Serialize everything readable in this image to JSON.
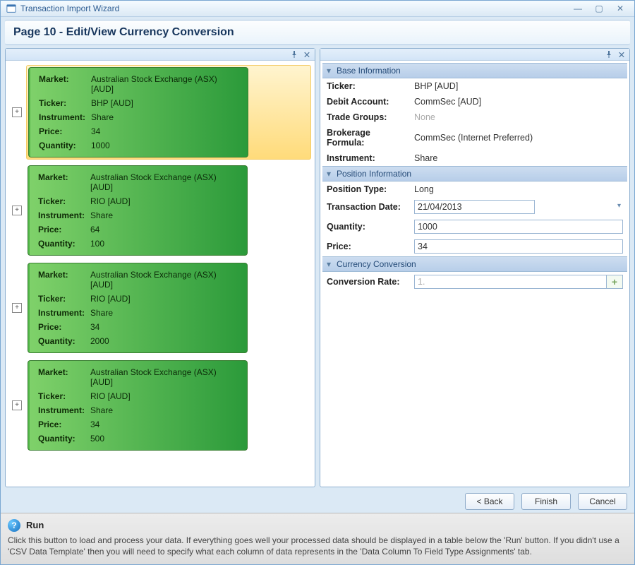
{
  "window": {
    "title": "Transaction Import Wizard"
  },
  "page_title": "Page 10 - Edit/View Currency Conversion",
  "records": [
    {
      "market": "Australian Stock Exchange (ASX) [AUD]",
      "ticker": "BHP [AUD]",
      "instrument": "Share",
      "price": "34",
      "quantity": "1000",
      "selected": true
    },
    {
      "market": "Australian Stock Exchange (ASX) [AUD]",
      "ticker": "RIO [AUD]",
      "instrument": "Share",
      "price": "64",
      "quantity": "100",
      "selected": false
    },
    {
      "market": "Australian Stock Exchange (ASX) [AUD]",
      "ticker": "RIO [AUD]",
      "instrument": "Share",
      "price": "34",
      "quantity": "2000",
      "selected": false
    },
    {
      "market": "Australian Stock Exchange (ASX) [AUD]",
      "ticker": "RIO [AUD]",
      "instrument": "Share",
      "price": "34",
      "quantity": "500",
      "selected": false
    }
  ],
  "labels": {
    "market": "Market:",
    "ticker_short": "Ticker:",
    "instrument_short": "Instrument:",
    "price_short": "Price:",
    "quantity_short": "Quantity:"
  },
  "sections": {
    "base": "Base Information",
    "position": "Position Information",
    "currency": "Currency Conversion"
  },
  "base": {
    "ticker_label": "Ticker:",
    "ticker": "BHP [AUD]",
    "debit_label": "Debit Account:",
    "debit": "CommSec [AUD]",
    "groups_label": "Trade Groups:",
    "groups": "None",
    "brokerage_label": "Brokerage Formula:",
    "brokerage": "CommSec (Internet Preferred)",
    "instrument_label": "Instrument:",
    "instrument": "Share"
  },
  "position": {
    "type_label": "Position Type:",
    "type": "Long",
    "date_label": "Transaction Date:",
    "date": "21/04/2013",
    "qty_label": "Quantity:",
    "qty": "1000",
    "price_label": "Price:",
    "price": "34"
  },
  "currency": {
    "rate_label": "Conversion Rate:",
    "rate": "1."
  },
  "buttons": {
    "back": "< Back",
    "finish": "Finish",
    "cancel": "Cancel"
  },
  "help": {
    "title": "Run",
    "body": "Click this button to load and process your data. If everything goes well your processed data should be displayed in a table below the 'Run' button. If you didn't use a 'CSV Data Template' then you will need to specify what each column of data represents in the 'Data Column To Field Type Assignments' tab."
  }
}
